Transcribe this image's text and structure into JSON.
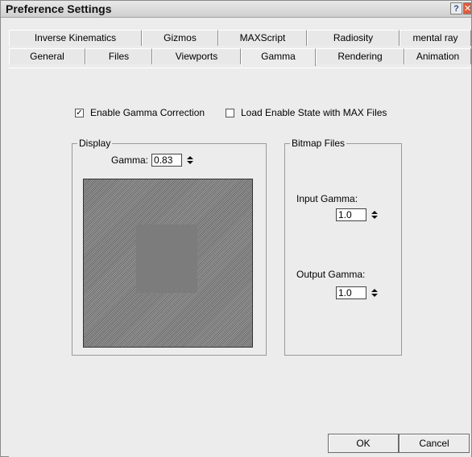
{
  "window": {
    "title": "Preference Settings",
    "help_glyph": "?",
    "close_glyph": "✕"
  },
  "tabs": {
    "row1": [
      "Inverse Kinematics",
      "Gizmos",
      "MAXScript",
      "Radiosity",
      "mental ray"
    ],
    "row2": [
      "General",
      "Files",
      "Viewports",
      "Gamma",
      "Rendering",
      "Animation"
    ],
    "active": "Gamma"
  },
  "options": {
    "enable_gamma": {
      "label": "Enable Gamma Correction",
      "checked": true
    },
    "load_enable_state": {
      "label": "Load Enable State with MAX Files",
      "checked": false
    }
  },
  "display": {
    "label": "Display",
    "gamma_label": "Gamma:",
    "gamma_value": "0.83"
  },
  "bitmap": {
    "label": "Bitmap Files",
    "input_label": "Input Gamma:",
    "input_value": "1.0",
    "output_label": "Output Gamma:",
    "output_value": "1.0"
  },
  "buttons": {
    "ok": "OK",
    "cancel": "Cancel"
  },
  "icons": {
    "help": "help-icon",
    "close": "close-icon",
    "spinner": "spinner-arrows-icon"
  }
}
